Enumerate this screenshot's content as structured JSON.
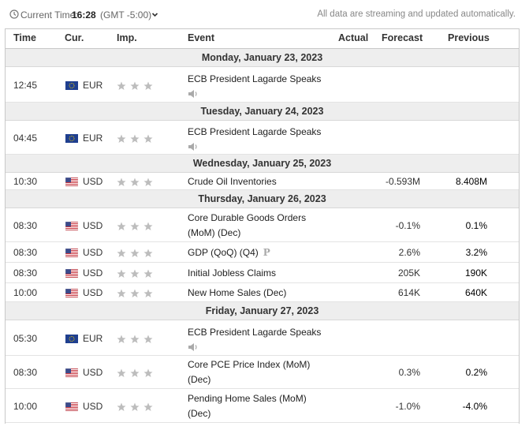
{
  "header": {
    "current_time_label": "Current Time:",
    "current_time": "16:28",
    "timezone": "(GMT -5:00)",
    "notice": "All data are streaming and updated automatically."
  },
  "columns": {
    "time": "Time",
    "currency": "Cur.",
    "importance": "Imp.",
    "event": "Event",
    "actual": "Actual",
    "forecast": "Forecast",
    "previous": "Previous"
  },
  "days": [
    {
      "label": "Monday, January 23, 2023",
      "events": [
        {
          "time": "12:45",
          "flag": "eu-flag",
          "currency": "EUR",
          "importance": 3,
          "event": [
            "ECB President Lagarde Speaks"
          ],
          "speech": true,
          "preliminary": false,
          "actual": "",
          "forecast": "",
          "previous": ""
        }
      ]
    },
    {
      "label": "Tuesday, January 24, 2023",
      "events": [
        {
          "time": "04:45",
          "flag": "eu-flag",
          "currency": "EUR",
          "importance": 3,
          "event": [
            "ECB President Lagarde Speaks"
          ],
          "speech": true,
          "preliminary": false,
          "actual": "",
          "forecast": "",
          "previous": ""
        }
      ]
    },
    {
      "label": "Wednesday, January 25, 2023",
      "events": [
        {
          "time": "10:30",
          "flag": "us-flag",
          "currency": "USD",
          "importance": 3,
          "event": [
            "Crude Oil Inventories"
          ],
          "speech": false,
          "preliminary": false,
          "actual": "",
          "forecast": "-0.593M",
          "previous": "8.408M"
        }
      ]
    },
    {
      "label": "Thursday, January 26, 2023",
      "events": [
        {
          "time": "08:30",
          "flag": "us-flag",
          "currency": "USD",
          "importance": 3,
          "event": [
            "Core Durable Goods Orders",
            "(MoM) (Dec)"
          ],
          "speech": false,
          "preliminary": false,
          "actual": "",
          "forecast": "-0.1%",
          "previous": "0.1%"
        },
        {
          "time": "08:30",
          "flag": "us-flag",
          "currency": "USD",
          "importance": 3,
          "event": [
            "GDP (QoQ) (Q4)"
          ],
          "speech": false,
          "preliminary": true,
          "preliminary_mark": "P",
          "actual": "",
          "forecast": "2.6%",
          "previous": "3.2%"
        },
        {
          "time": "08:30",
          "flag": "us-flag",
          "currency": "USD",
          "importance": 3,
          "event": [
            "Initial Jobless Claims"
          ],
          "speech": false,
          "preliminary": false,
          "actual": "",
          "forecast": "205K",
          "previous": "190K"
        },
        {
          "time": "10:00",
          "flag": "us-flag",
          "currency": "USD",
          "importance": 3,
          "event": [
            "New Home Sales (Dec)"
          ],
          "speech": false,
          "preliminary": false,
          "actual": "",
          "forecast": "614K",
          "previous": "640K"
        }
      ]
    },
    {
      "label": "Friday, January 27, 2023",
      "events": [
        {
          "time": "05:30",
          "flag": "eu-flag",
          "currency": "EUR",
          "importance": 3,
          "event": [
            "ECB President Lagarde Speaks"
          ],
          "speech": true,
          "preliminary": false,
          "actual": "",
          "forecast": "",
          "previous": ""
        },
        {
          "time": "08:30",
          "flag": "us-flag",
          "currency": "USD",
          "importance": 3,
          "event": [
            "Core PCE Price Index (MoM)",
            "(Dec)"
          ],
          "speech": false,
          "preliminary": false,
          "actual": "",
          "forecast": "0.3%",
          "previous": "0.2%"
        },
        {
          "time": "10:00",
          "flag": "us-flag",
          "currency": "USD",
          "importance": 3,
          "event": [
            "Pending Home Sales (MoM)",
            "(Dec)"
          ],
          "speech": false,
          "preliminary": false,
          "actual": "",
          "forecast": "-1.0%",
          "previous": "-4.0%"
        }
      ]
    }
  ],
  "colors": {
    "day_band": "#eeeeee",
    "star": "#bdbdbd",
    "border": "#c8c8c8"
  }
}
